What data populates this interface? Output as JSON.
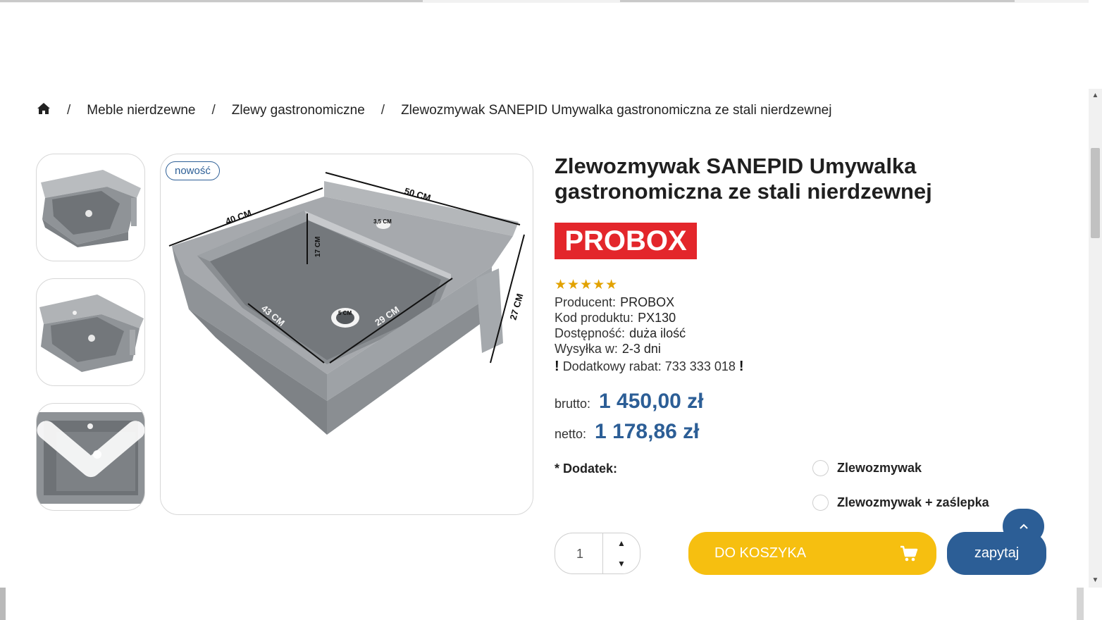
{
  "breadcrumb": {
    "home_icon": "home-icon",
    "separator": "/",
    "items": [
      "Meble nierdzewne",
      "Zlewy gastronomiczne",
      "Zlewozmywak SANEPID Umywalka gastronomiczna ze stali nierdzewnej"
    ]
  },
  "gallery": {
    "badge": "nowość",
    "dimensions": {
      "width": "50 CM",
      "depth": "40 CM",
      "height": "27 CM",
      "bowl_depth": "17 CM",
      "bowl_length": "43 CM",
      "bowl_width": "29 CM",
      "hole_small": "3,5 CM",
      "drain": "5 CM"
    },
    "thumb_nav_icon": "chevron-down-icon"
  },
  "product": {
    "title": "Zlewozmywak SANEPID Umywalka gastronomiczna ze stali nierdzewnej",
    "brand_logo": "PROBOX",
    "rating": "★★★★★",
    "info": [
      {
        "label": "Producent:",
        "value": "PROBOX"
      },
      {
        "label": "Kod produktu:",
        "value": "PX130"
      },
      {
        "label": "Dostępność:",
        "value": "duża ilość"
      },
      {
        "label": "Wysyłka w:",
        "value": "2-3 dni"
      }
    ],
    "discount": {
      "mark": "!",
      "text": "Dodatkowy rabat: 733 333 018"
    },
    "price": {
      "gross_label": "brutto:",
      "gross": "1 450,00 zł",
      "net_label": "netto:",
      "net": "1 178,86 zł"
    },
    "addon": {
      "label": "* Dodatek:",
      "options": [
        "Zlewozmywak",
        "Zlewozmywak + zaślepka"
      ]
    },
    "quantity": "1",
    "cart_button": "DO KOSZYKA",
    "cart_icon": "cart-icon",
    "ask_button": "zapytaj",
    "to_top_icon": "chevron-up-icon"
  },
  "colors": {
    "accent_blue": "#2c5e96",
    "cart_yellow": "#f6bf10",
    "brand_red": "#e3262b",
    "star": "#e2a200"
  }
}
